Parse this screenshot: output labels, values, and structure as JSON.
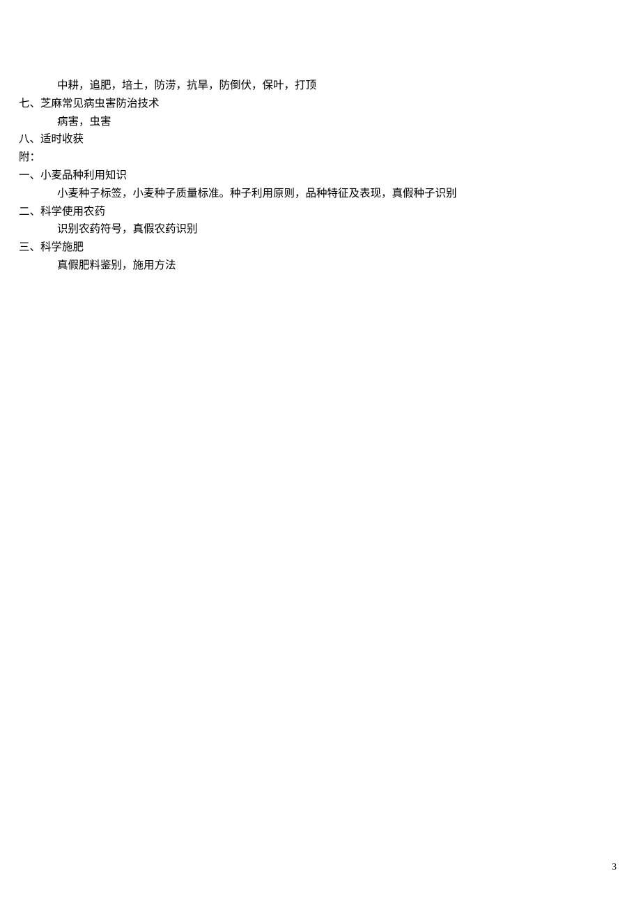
{
  "lines": [
    {
      "text": "中耕，追肥，培土，防涝，抗旱，防倒伏，保叶，打顶",
      "indent": 2
    },
    {
      "text": "七、芝麻常见病虫害防治技术",
      "indent": 1
    },
    {
      "text": "病害，虫害",
      "indent": 2
    },
    {
      "text": "八、适时收获",
      "indent": 1
    },
    {
      "text": "附：",
      "indent": 1
    },
    {
      "text": "一、小麦品种利用知识",
      "indent": 1
    },
    {
      "text": "小麦种子标签，小麦种子质量标准。种子利用原则，品种特征及表现，真假种子识别",
      "indent": 2
    },
    {
      "text": "二、科学使用农药",
      "indent": 1
    },
    {
      "text": "识别农药符号，真假农药识别",
      "indent": 2
    },
    {
      "text": "三、科学施肥",
      "indent": 1
    },
    {
      "text": "真假肥料鉴别，施用方法",
      "indent": 2
    }
  ],
  "pageNumber": "3"
}
